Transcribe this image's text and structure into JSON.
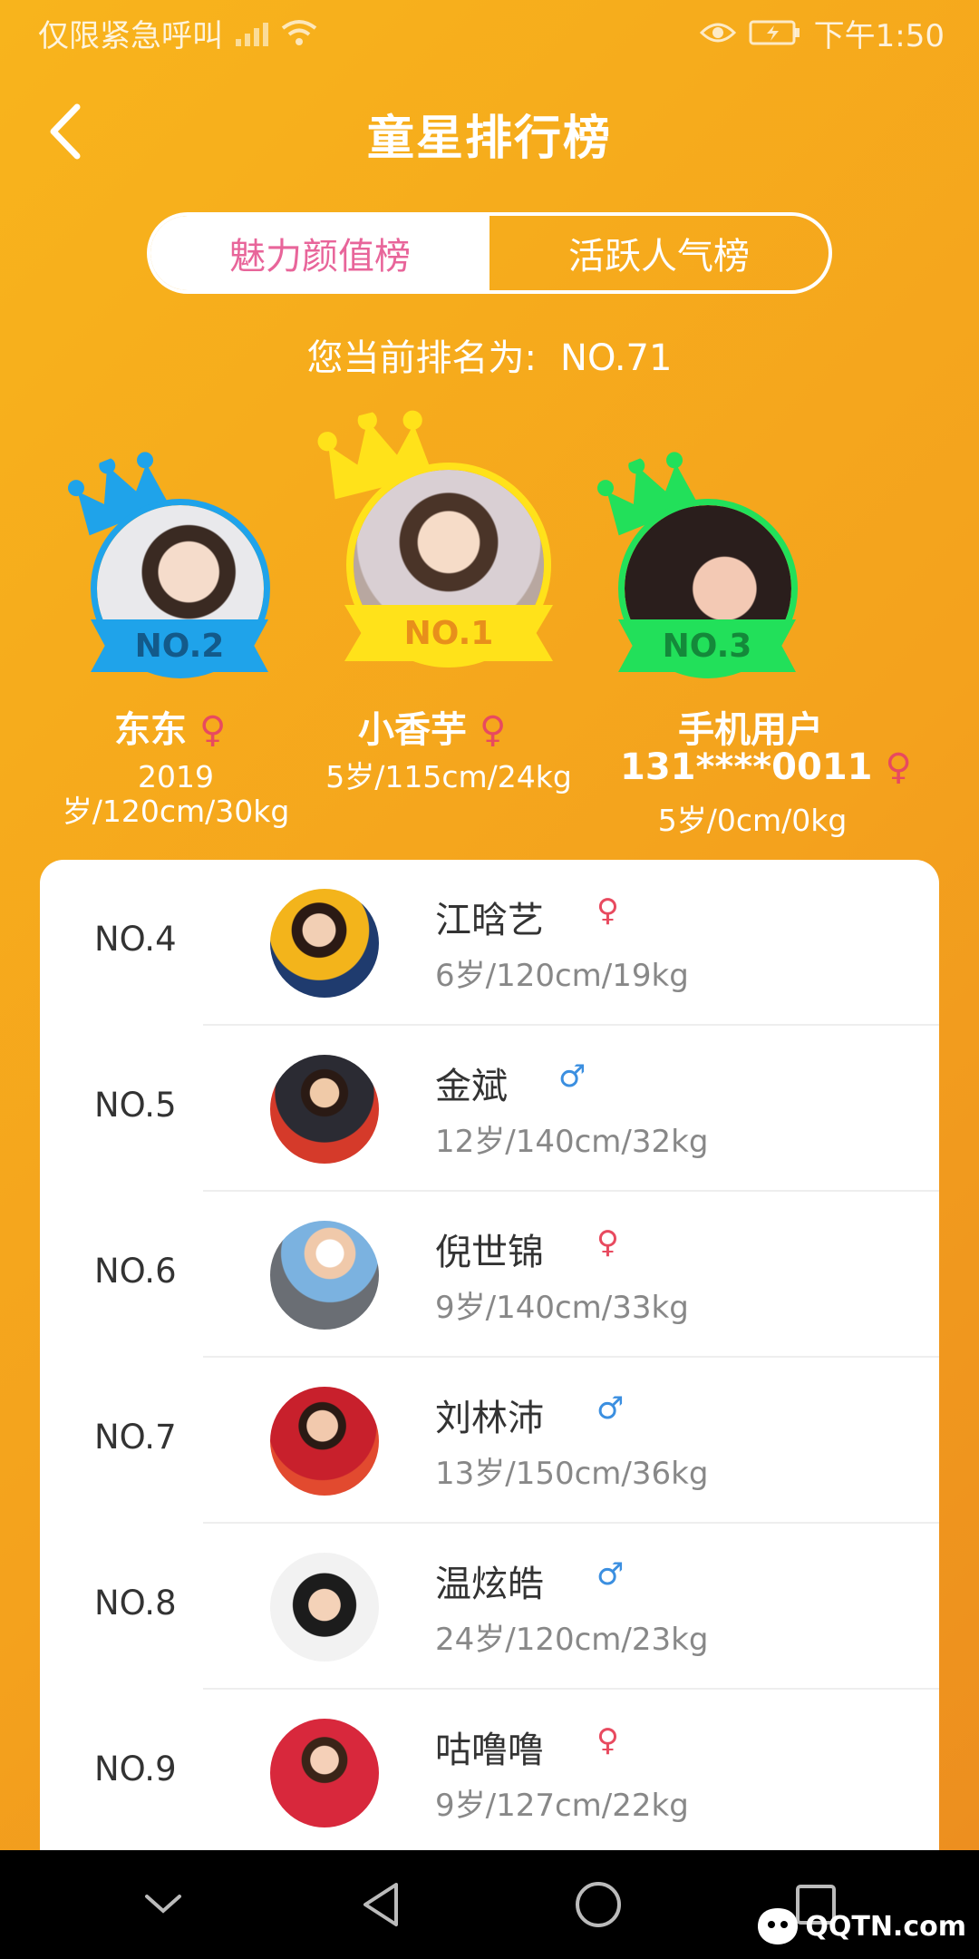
{
  "status_bar": {
    "carrier_text": "仅限紧急呼叫",
    "time": "下午1:50",
    "icons": [
      "no-signal-icon",
      "wifi-icon",
      "eye-icon",
      "battery-charging-icon"
    ]
  },
  "header": {
    "back_icon": "chevron-left-icon",
    "title": "童星排行榜"
  },
  "tabs": [
    {
      "label": "魅力颜值榜",
      "active": true
    },
    {
      "label": "活跃人气榜",
      "active": false
    }
  ],
  "my_rank": {
    "label": "您当前排名为:",
    "value": "NO.71"
  },
  "podium": [
    {
      "rank": "NO.2",
      "name": "东东",
      "gender": "female",
      "gender_symbol": "♀",
      "stats_line1": "2019",
      "stats_line2": "岁/120cm/30kg",
      "color": "#1fa3ea"
    },
    {
      "rank": "NO.1",
      "name": "小香芋",
      "gender": "female",
      "gender_symbol": "♀",
      "stats_line1": "5岁/115cm/24kg",
      "stats_line2": "",
      "color": "#ffe21a"
    },
    {
      "rank": "NO.3",
      "name": "手机用户",
      "name_line2": "131****0011",
      "gender": "female",
      "gender_symbol": "♀",
      "stats_line1": "5岁/0cm/0kg",
      "stats_line2": "",
      "color": "#22e05a"
    }
  ],
  "list": [
    {
      "rank": "NO.4",
      "name": "江晗艺",
      "gender": "female",
      "gender_symbol": "♀",
      "stats": "6岁/120cm/19kg"
    },
    {
      "rank": "NO.5",
      "name": "金斌",
      "gender": "male",
      "gender_symbol": "♂",
      "stats": "12岁/140cm/32kg"
    },
    {
      "rank": "NO.6",
      "name": "倪世锦",
      "gender": "female",
      "gender_symbol": "♀",
      "stats": "9岁/140cm/33kg"
    },
    {
      "rank": "NO.7",
      "name": "刘林沛",
      "gender": "male",
      "gender_symbol": "♂",
      "stats": "13岁/150cm/36kg"
    },
    {
      "rank": "NO.8",
      "name": "温炫皓",
      "gender": "male",
      "gender_symbol": "♂",
      "stats": "24岁/120cm/23kg"
    },
    {
      "rank": "NO.9",
      "name": "咕噜噜",
      "gender": "female",
      "gender_symbol": "♀",
      "stats": "9岁/127cm/22kg"
    }
  ],
  "nav_bar": {
    "icons": [
      "collapse-chevron-icon",
      "back-triangle-icon",
      "home-circle-icon",
      "recents-square-icon"
    ]
  },
  "watermark": {
    "text": "QQTN.com"
  },
  "colors": {
    "background": "#f4a21d",
    "tab_active_text": "#e8659a",
    "female": "#e84a5f",
    "male": "#3b8fe0"
  }
}
